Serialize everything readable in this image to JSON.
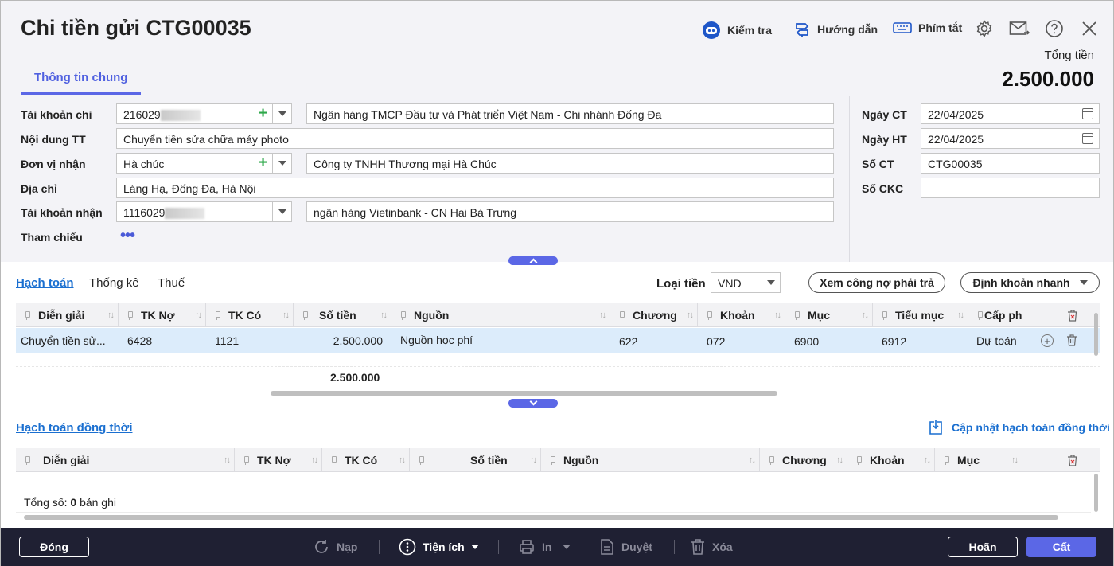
{
  "header": {
    "title": "Chi tiền gửi CTG00035",
    "check_label": "Kiểm tra",
    "guide_label": "Hướng dẫn",
    "shortcut_label": "Phím tắt",
    "total_label": "Tổng tiền",
    "total_value": "2.500.000"
  },
  "tabs": {
    "general": "Thông tin chung"
  },
  "form": {
    "account_label": "Tài khoản chi",
    "account_value": "216029",
    "bank_name": "Ngân hàng TMCP Đầu tư và Phát triển Việt Nam - Chi nhánh Đống Đa",
    "content_label": "Nội dung TT",
    "content_value": "Chuyển tiền sửa chữa máy photo",
    "receiver_label": "Đơn vị nhận",
    "receiver_value": "Hà chúc",
    "receiver_name": "Công ty TNHH Thương mại Hà Chúc",
    "address_label": "Địa chỉ",
    "address_value": "Láng Hạ, Đống Đa, Hà Nội",
    "recv_account_label": "Tài khoản nhận",
    "recv_account_value": "1116029",
    "recv_bank_name": "ngân hàng Vietinbank - CN Hai Bà Trưng",
    "reference_label": "Tham chiếu",
    "voucher_date_label": "Ngày CT",
    "voucher_date_value": "22/04/2025",
    "posting_date_label": "Ngày HT",
    "posting_date_value": "22/04/2025",
    "voucher_no_label": "Số CT",
    "voucher_no_value": "CTG00035",
    "ckc_label": "Số CKC",
    "ckc_value": ""
  },
  "detail": {
    "tabs": [
      "Hạch toán",
      "Thống kê",
      "Thuế"
    ],
    "currency_label": "Loại tiền",
    "currency_value": "VND",
    "debt_button": "Xem công nợ phải trả",
    "quick_entry_button": "Định khoản nhanh",
    "columns": [
      "Diễn giải",
      "TK Nợ",
      "TK Có",
      "Số tiền",
      "Nguồn",
      "Chương",
      "Khoản",
      "Mục",
      "Tiểu mục",
      "Cấp phát"
    ],
    "rows": [
      [
        "Chuyển tiền sửa chữa máy photo",
        "6428",
        "1121",
        "2.500.000",
        "Nguồn học phí",
        "622",
        "072",
        "6900",
        "6912",
        "Dự toán"
      ]
    ],
    "row_desc_display": "Chuyển tiền sử...",
    "total_amount": "2.500.000"
  },
  "simultaneous": {
    "title": "Hạch toán đồng thời",
    "update_button": "Cập nhật hạch toán đồng thời",
    "columns": [
      "Diễn giải",
      "TK Nợ",
      "TK Có",
      "Số tiền",
      "Nguồn",
      "Chương",
      "Khoản",
      "Mục"
    ],
    "summary_prefix": "Tổng số:",
    "summary_count": "0",
    "summary_suffix": "bản ghi"
  },
  "footer": {
    "close": "Đóng",
    "reload": "Nạp",
    "utilities": "Tiện ích",
    "print": "In",
    "approve": "Duyệt",
    "delete": "Xóa",
    "cancel": "Hoãn",
    "save": "Cất"
  },
  "colors": {
    "accent": "#5b67e6",
    "link": "#1a6fd0",
    "footer_bg": "#1f2033",
    "selected_row": "#dcecfb"
  }
}
